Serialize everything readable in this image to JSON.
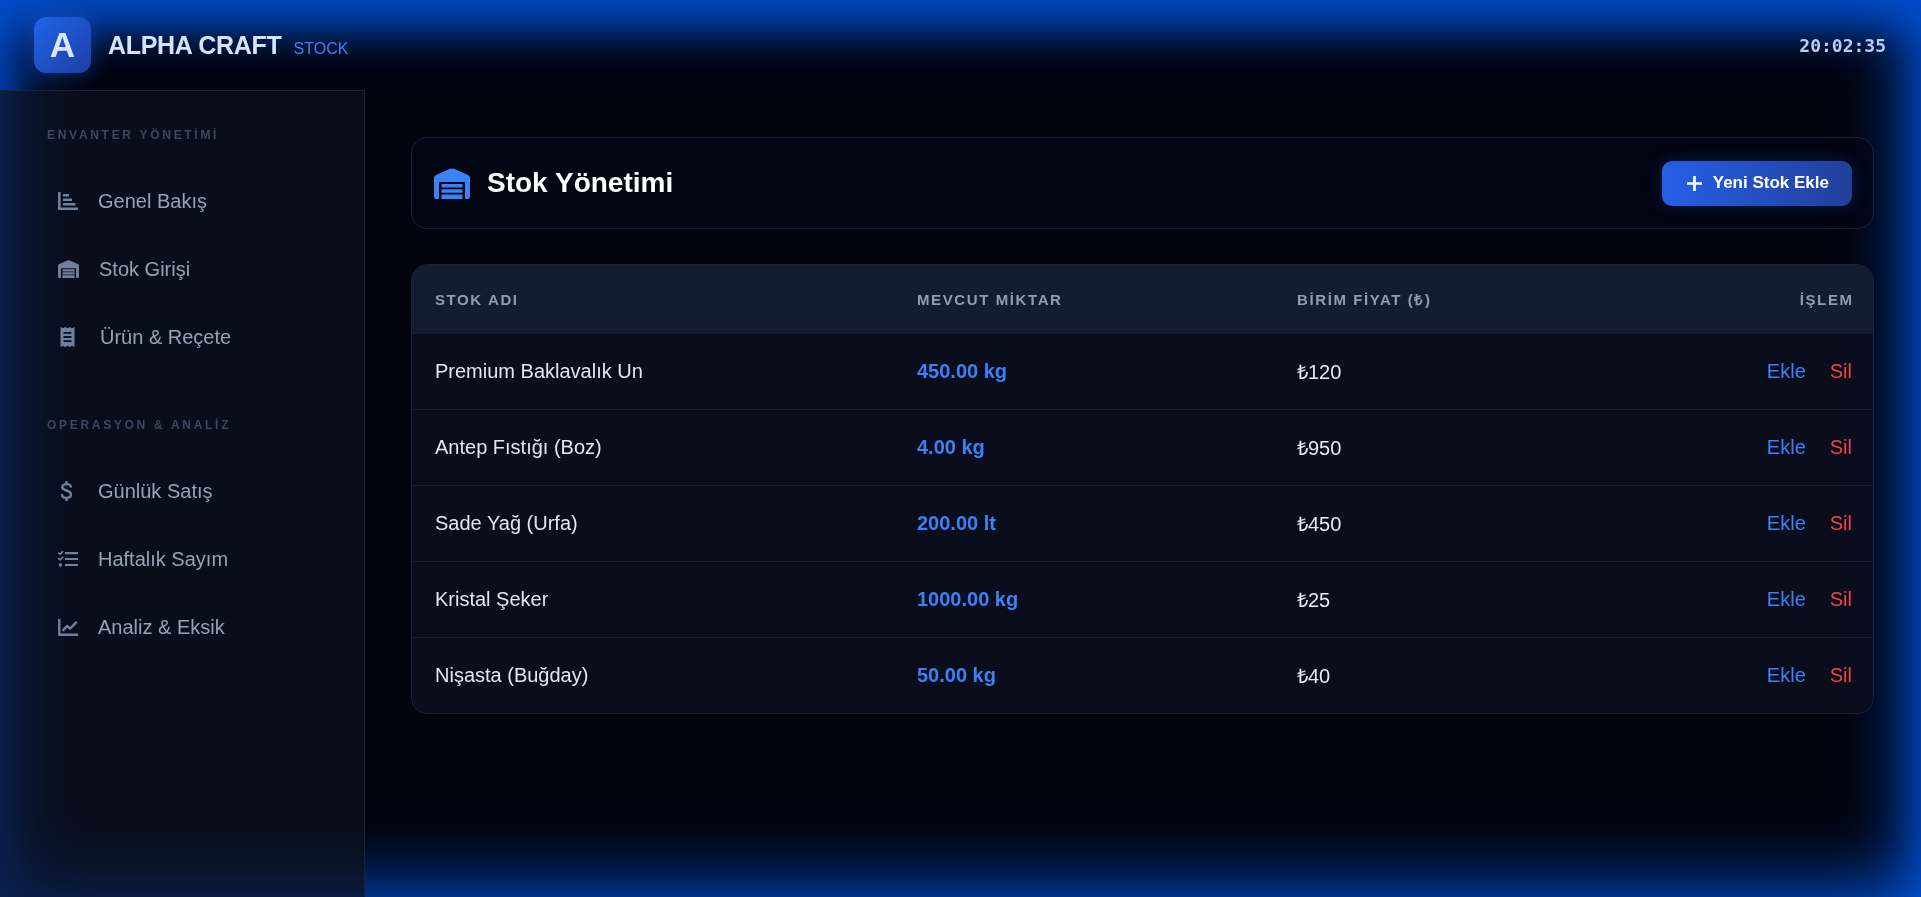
{
  "header": {
    "logo_letter": "A",
    "brand": "ALPHA CRAFT",
    "brand_tag": "STOCK",
    "clock": "20:02:35"
  },
  "sidebar": {
    "sections": [
      {
        "title": "ENVANTER YÖNETİMİ",
        "items": [
          {
            "label": "Genel Bakış",
            "selected": false
          },
          {
            "label": "Stok Girişi",
            "selected": false
          },
          {
            "label": "Ürün & Reçete",
            "selected": false
          }
        ]
      },
      {
        "title": "OPERASYON & ANALİZ",
        "items": [
          {
            "label": "Günlük Satış",
            "selected": false
          },
          {
            "label": "Haftalık Sayım",
            "selected": false
          },
          {
            "label": "Analiz & Eksik",
            "selected": false
          }
        ]
      }
    ]
  },
  "page": {
    "title": "Stok Yönetimi",
    "add_button": "Yeni Stok Ekle"
  },
  "table": {
    "columns": [
      "STOK ADI",
      "MEVCUT MİKTAR",
      "BİRİM FİYAT (₺)",
      "İŞLEM"
    ],
    "rows": [
      {
        "name": "Premium Baklavalık Un",
        "quantity": "450.00 kg",
        "price": "₺120",
        "actions": [
          {
            "label": "Ekle",
            "kind": "add"
          },
          {
            "label": "Sil",
            "kind": "delete"
          }
        ]
      },
      {
        "name": "Antep Fıstığı (Boz)",
        "quantity": "4.00 kg",
        "price": "₺950",
        "actions": [
          {
            "label": "Ekle",
            "kind": "add"
          },
          {
            "label": "Sil",
            "kind": "delete"
          }
        ]
      },
      {
        "name": "Sade Yağ (Urfa)",
        "quantity": "200.00 lt",
        "price": "₺450",
        "actions": [
          {
            "label": "Ekle",
            "kind": "add"
          },
          {
            "label": "Sil",
            "kind": "delete"
          }
        ]
      },
      {
        "name": "Kristal Şeker",
        "quantity": "1000.00 kg",
        "price": "₺25",
        "actions": [
          {
            "label": "Ekle",
            "kind": "add"
          },
          {
            "label": "Sil",
            "kind": "delete"
          }
        ]
      },
      {
        "name": "Nişasta (Buğday)",
        "quantity": "50.00 kg",
        "price": "₺40",
        "actions": [
          {
            "label": "Ekle",
            "kind": "add"
          },
          {
            "label": "Sil",
            "kind": "delete"
          }
        ]
      }
    ]
  }
}
